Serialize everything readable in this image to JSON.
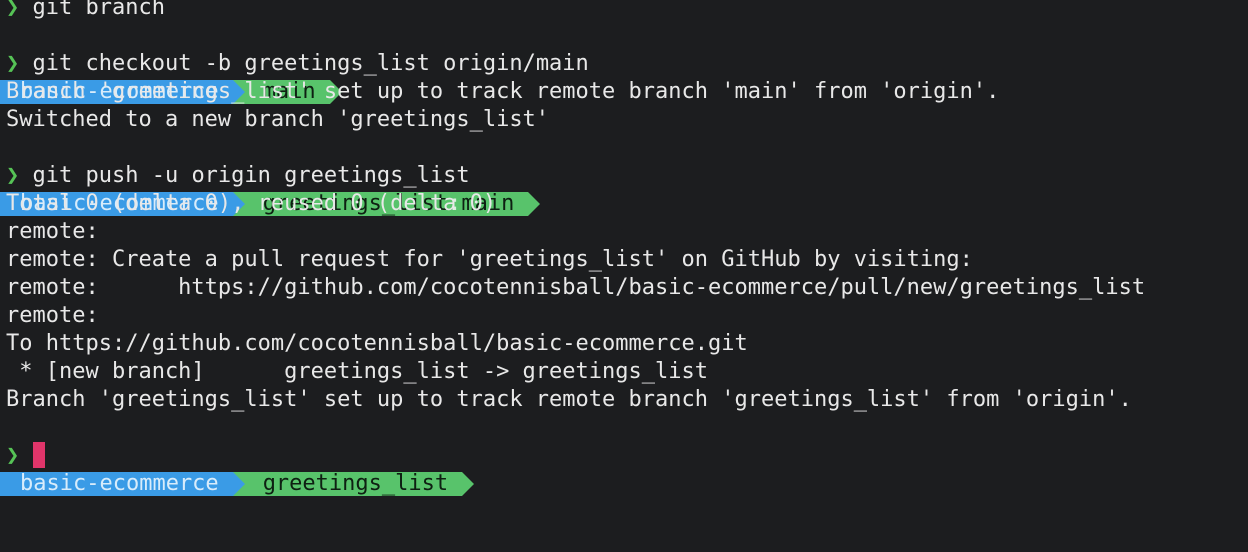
{
  "prompt_symbol": "❯",
  "lines": [
    {
      "kind": "cmd",
      "text": "git branch"
    },
    {
      "kind": "prompt",
      "dir": "basic-ecommerce",
      "branch": "main",
      "upstream": ""
    },
    {
      "kind": "cmd",
      "text": "git checkout -b greetings_list origin/main"
    },
    {
      "kind": "out",
      "text": "Branch 'greetings_list' set up to track remote branch 'main' from 'origin'."
    },
    {
      "kind": "out",
      "text": "Switched to a new branch 'greetings_list'"
    },
    {
      "kind": "prompt",
      "dir": "basic-ecommerce",
      "branch": "greetings_list",
      "upstream_sep": ":",
      "upstream": "main"
    },
    {
      "kind": "cmd",
      "text": "git push -u origin greetings_list"
    },
    {
      "kind": "out",
      "text": "Total 0 (delta 0), reused 0 (delta 0)"
    },
    {
      "kind": "out",
      "text": "remote:"
    },
    {
      "kind": "out",
      "text": "remote: Create a pull request for 'greetings_list' on GitHub by visiting:"
    },
    {
      "kind": "out",
      "text": "remote:      https://github.com/cocotennisball/basic-ecommerce/pull/new/greetings_list"
    },
    {
      "kind": "out",
      "text": "remote:"
    },
    {
      "kind": "out",
      "text": "To https://github.com/cocotennisball/basic-ecommerce.git"
    },
    {
      "kind": "out",
      "text": " * [new branch]      greetings_list -> greetings_list"
    },
    {
      "kind": "out",
      "text": "Branch 'greetings_list' set up to track remote branch 'greetings_list' from 'origin'."
    },
    {
      "kind": "prompt",
      "dir": "basic-ecommerce",
      "branch": "greetings_list",
      "upstream": ""
    },
    {
      "kind": "input",
      "text": ""
    }
  ],
  "colors": {
    "background": "#1c1d1f",
    "dir_segment": "#3a9be6",
    "git_segment": "#58c36b",
    "prompt_chevron": "#56c356",
    "cursor": "#e0356a"
  }
}
